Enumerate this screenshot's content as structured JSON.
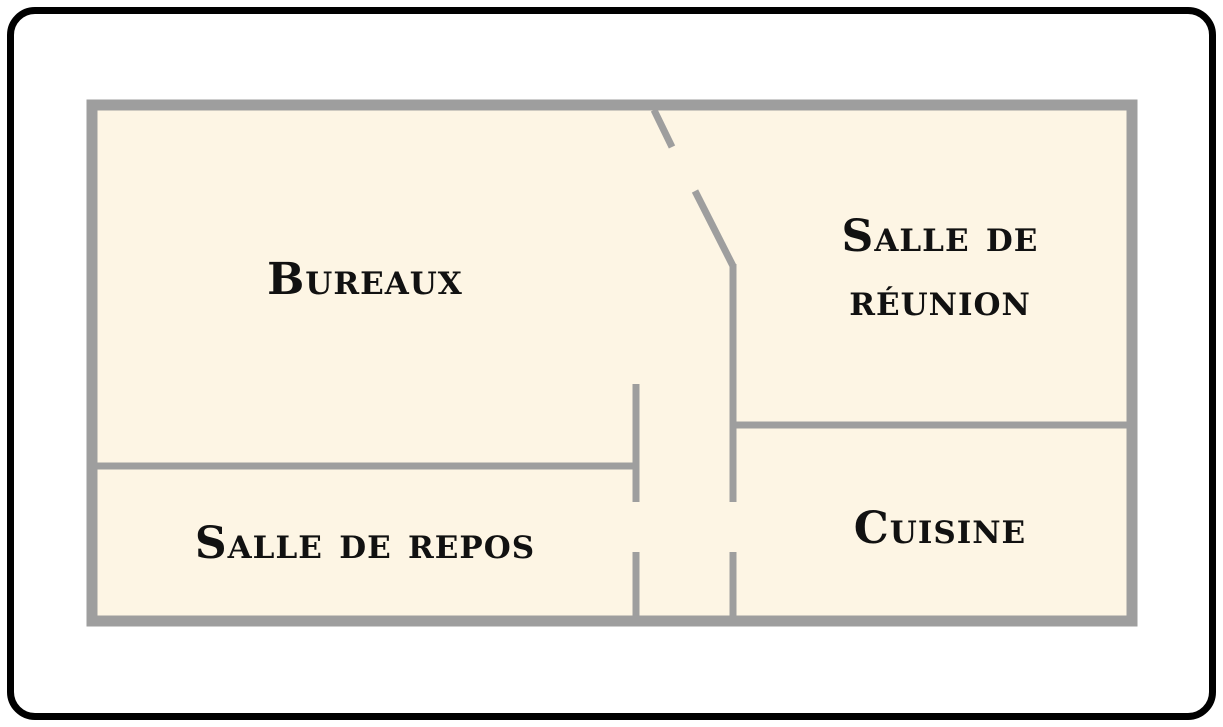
{
  "floorplan": {
    "rooms": {
      "bureaux": "Bureaux",
      "salle_de_reunion": "Salle de réunion",
      "salle_de_repos": "Salle de repos",
      "cuisine": "Cuisine"
    },
    "colors": {
      "floor": "#fdf5e4",
      "wall": "#9e9e9e",
      "frame": "#000000",
      "text": "#111111"
    }
  }
}
